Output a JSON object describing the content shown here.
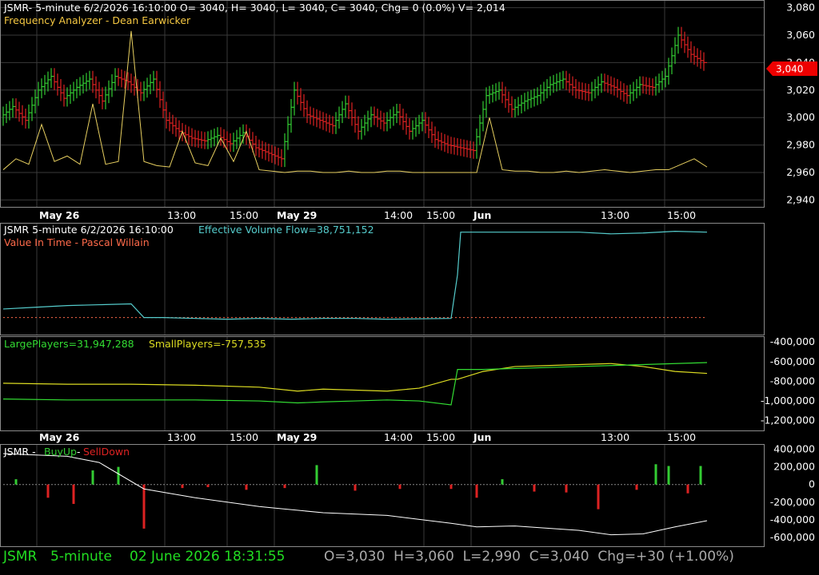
{
  "colors": {
    "background": "#000000",
    "grid": "#3a3a3a",
    "border": "#8a8a8a",
    "up": "#33cc33",
    "down": "#dd2222",
    "freq_line": "#e8d060",
    "volume_flow": "#55cccc",
    "value_in_time": "#ff6a4a",
    "large_players": "#33dd33",
    "small_players": "#dddd22",
    "buy_sell_line": "#ffffff",
    "price_marker": "#ee0000",
    "status_green": "#22dd22",
    "status_gray": "#aaaaaa"
  },
  "x_axis_labels": [
    {
      "text": "May 26",
      "bold": true,
      "grid": true
    },
    {
      "text": "13:00",
      "bold": false,
      "grid": true
    },
    {
      "text": "15:00",
      "bold": false,
      "grid": true
    },
    {
      "text": "May 29",
      "bold": true,
      "grid": true
    },
    {
      "text": "14:00",
      "bold": false,
      "grid": false
    },
    {
      "text": "15:00",
      "bold": false,
      "grid": true
    },
    {
      "text": "Jun",
      "bold": true,
      "grid": true
    },
    {
      "text": "13:00",
      "bold": false,
      "grid": false
    },
    {
      "text": "15:00",
      "bold": false,
      "grid": true
    }
  ],
  "price_panel": {
    "header": "JSMR- 5-minute 6/2/2026 16:10:00 O= 3040, H= 3040, L= 3040, C= 3040, Chg= 0 (0.0%) V= 2,014",
    "indicator_label": "Frequency Analyzer - Dean Earwicker",
    "y_ticks": [
      "3,080",
      "3,060",
      "3,040",
      "3,020",
      "3,000",
      "2,980",
      "2,960",
      "2,940"
    ],
    "last_price": "3,040"
  },
  "volume_panel": {
    "header_symbol": "JSMR 5-minute  6/2/2026 16:10:00",
    "header_indicator": "Effective Volume Flow=38,751,152",
    "indicator_label": "Value In Time - Pascal Willain"
  },
  "players_panel": {
    "large_label": "LargePlayers=31,947,288",
    "small_label": "SmallPlayers=-757,535",
    "y_ticks": [
      "-400,000",
      "-600,000",
      "-800,000",
      "-1,000,000",
      "-1,200,000"
    ]
  },
  "buysell_panel": {
    "label_prefix": "JSMR - ",
    "buy_label": "BuyUp",
    "sep": "-",
    "sell_label": "SellDown",
    "y_ticks": [
      "400,000",
      "200,000",
      "0",
      "-200,000",
      "-400,000",
      "-600,000"
    ]
  },
  "status_bar": {
    "symbol": "JSMR",
    "interval": "5-minute",
    "datetime": "02 June 2026 18:31:55",
    "ohlc": "O=3,030  H=3,060  L=2,990  C=3,040  Chg=+30 (+1.00%)"
  },
  "chart_data": [
    {
      "type": "line",
      "name": "price",
      "ylim": [
        2935,
        3085
      ],
      "y_ticks": [
        3080,
        3060,
        3040,
        3020,
        3000,
        2980,
        2960,
        2940
      ],
      "x": [
        0,
        4,
        8,
        12,
        16,
        20,
        24,
        28,
        32,
        36,
        40,
        44,
        48,
        52,
        56,
        60,
        64,
        68,
        72,
        76,
        80,
        84,
        88,
        92,
        96,
        100,
        104,
        108,
        112,
        116,
        120,
        124,
        128,
        132,
        136,
        140,
        144,
        148,
        152,
        156,
        160,
        164,
        168,
        172,
        176,
        180,
        184,
        188,
        192,
        196,
        200,
        204,
        208,
        212,
        216,
        220
      ],
      "values": [
        3000,
        3008,
        2998,
        3020,
        3030,
        3014,
        3022,
        3028,
        3012,
        3030,
        3026,
        3018,
        3028,
        2998,
        2990,
        2985,
        2983,
        2987,
        2981,
        2989,
        2978,
        2974,
        2970,
        3020,
        3002,
        2998,
        2994,
        3010,
        2990,
        3002,
        2996,
        3004,
        2990,
        2998,
        2984,
        2980,
        2978,
        2976,
        3016,
        3020,
        3006,
        3012,
        3016,
        3024,
        3028,
        3020,
        3018,
        3026,
        3022,
        3016,
        3024,
        3022,
        3030,
        3060,
        3046,
        3040
      ],
      "freq_values": [
        2962,
        2970,
        2966,
        2995,
        2968,
        2972,
        2966,
        3010,
        2966,
        2968,
        3063,
        2968,
        2965,
        2964,
        2990,
        2967,
        2965,
        2985,
        2968,
        2990,
        2962,
        2961,
        2960,
        2961,
        2961,
        2960,
        2960,
        2961,
        2960,
        2960,
        2961,
        2961,
        2960,
        2960,
        2960,
        2960,
        2960,
        2960,
        3000,
        2962,
        2961,
        2961,
        2960,
        2960,
        2961,
        2960,
        2961,
        2962,
        2961,
        2960,
        2961,
        2962,
        2962,
        2966,
        2970,
        2964
      ]
    },
    {
      "type": "line",
      "name": "Effective Volume Flow",
      "ylim": [
        -20,
        110
      ],
      "x": [
        0,
        10,
        20,
        30,
        40,
        44,
        50,
        60,
        70,
        80,
        90,
        100,
        110,
        120,
        140,
        142,
        143,
        160,
        180,
        190,
        200,
        210,
        220
      ],
      "values": [
        10,
        12,
        14,
        15,
        16,
        0,
        0,
        -1,
        -2,
        -1,
        -2,
        -1,
        -1,
        -2,
        -1,
        50,
        100,
        100,
        100,
        98,
        99,
        101,
        100
      ]
    },
    {
      "type": "line",
      "name": "LargePlayers / SmallPlayers",
      "ylim": [
        -1300000,
        -350000
      ],
      "x": [
        0,
        20,
        40,
        60,
        80,
        92,
        100,
        110,
        120,
        130,
        140,
        142,
        150,
        160,
        170,
        180,
        190,
        200,
        210,
        220
      ],
      "small_values": [
        -820000,
        -830000,
        -830000,
        -840000,
        -860000,
        -900000,
        -880000,
        -890000,
        -900000,
        -870000,
        -780000,
        -780000,
        -700000,
        -650000,
        -640000,
        -630000,
        -620000,
        -650000,
        -700000,
        -720000
      ],
      "large_values": [
        -980000,
        -990000,
        -990000,
        -990000,
        -1000000,
        -1020000,
        -1010000,
        -1000000,
        -990000,
        -1000000,
        -1040000,
        -680000,
        -680000,
        -670000,
        -660000,
        -650000,
        -640000,
        -630000,
        -620000,
        -610000
      ]
    },
    {
      "type": "bar",
      "name": "BuyUp-SellDown",
      "ylim": [
        -700000,
        450000
      ],
      "x": [
        4,
        14,
        22,
        28,
        36,
        44,
        56,
        64,
        76,
        88,
        98,
        110,
        124,
        140,
        148,
        156,
        166,
        176,
        186,
        198,
        204,
        208,
        214,
        218
      ],
      "values": [
        60000,
        -150000,
        -220000,
        160000,
        200000,
        -500000,
        -40000,
        -30000,
        -60000,
        -40000,
        220000,
        -70000,
        -50000,
        -50000,
        -150000,
        60000,
        -80000,
        -90000,
        -280000,
        -60000,
        230000,
        210000,
        -100000,
        210000
      ],
      "line_x": [
        0,
        20,
        30,
        44,
        60,
        80,
        100,
        120,
        140,
        148,
        160,
        180,
        190,
        200,
        210,
        220
      ],
      "line_values": [
        350000,
        320000,
        250000,
        -50000,
        -150000,
        -250000,
        -320000,
        -350000,
        -440000,
        -480000,
        -470000,
        -520000,
        -570000,
        -560000,
        -480000,
        -410000
      ]
    }
  ]
}
